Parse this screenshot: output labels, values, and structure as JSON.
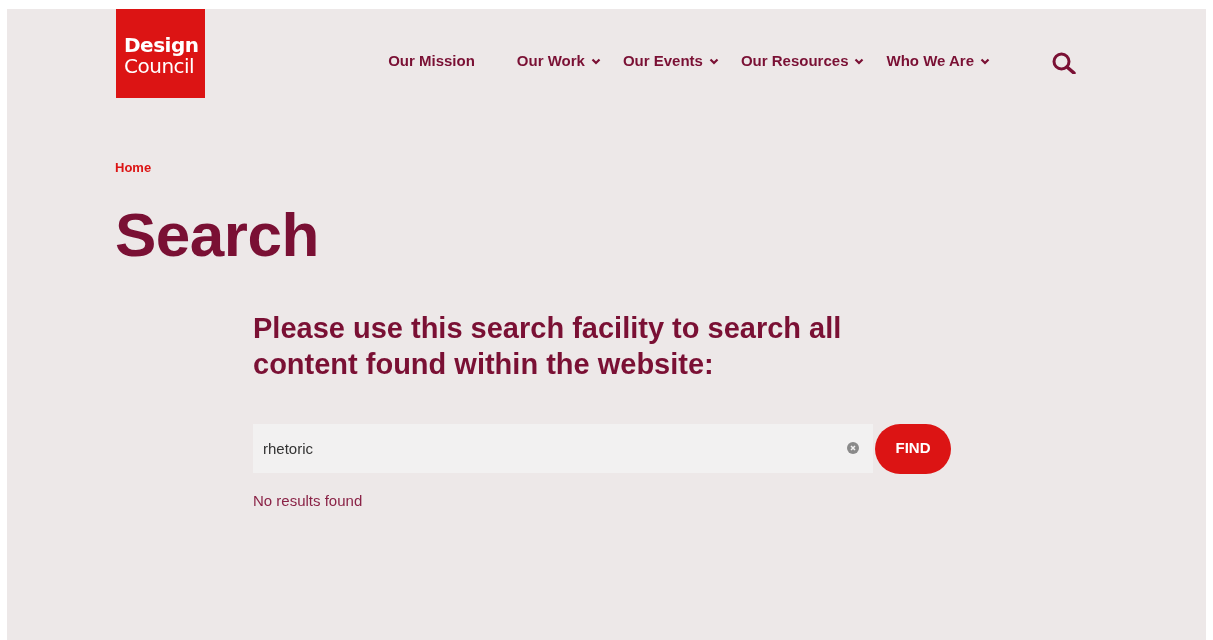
{
  "logo": {
    "line_1": "Design",
    "line_2": "Council"
  },
  "nav": [
    {
      "label": "Our Mission",
      "has_menu": false
    },
    {
      "label": "Our Work",
      "has_menu": true
    },
    {
      "label": "Our Events",
      "has_menu": true
    },
    {
      "label": "Our Resources",
      "has_menu": true
    },
    {
      "label": "Who We Are",
      "has_menu": true
    }
  ],
  "breadcrumb": [
    "Home"
  ],
  "title": "Search",
  "intro": "Please use this search facility to search all content found within the website:",
  "search": {
    "value": "rhetoric",
    "button": "FIND"
  },
  "result_message": "No results found"
}
